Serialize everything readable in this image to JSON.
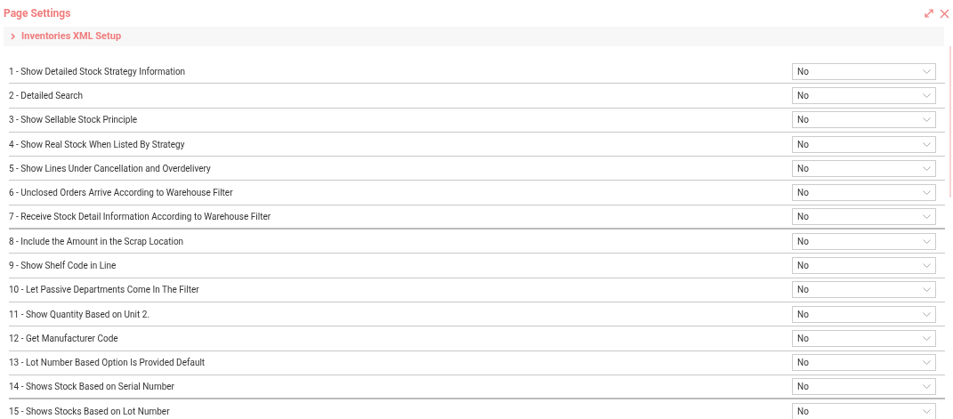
{
  "title": "Page Settings",
  "section": {
    "label": "Inventories XML Setup",
    "expanded": false
  },
  "settings": [
    {
      "label": "1 - Show Detailed Stock Strategy Information",
      "value": "No"
    },
    {
      "label": "2 - Detailed Search",
      "value": "No"
    },
    {
      "label": "3 - Show Sellable Stock Principle",
      "value": "No"
    },
    {
      "label": "4 - Show Real Stock When Listed By Strategy",
      "value": "No"
    },
    {
      "label": "5 - Show Lines Under Cancellation and Overdelivery",
      "value": "No"
    },
    {
      "label": "6 - Unclosed Orders Arrive According to Warehouse Filter",
      "value": "No"
    },
    {
      "label": "7 - Receive Stock Detail Information According to Warehouse Filter",
      "value": "No"
    },
    {
      "label": "8 - Include the Amount in the Scrap Location",
      "value": "No"
    },
    {
      "label": "9 - Show Shelf Code in Line",
      "value": "No"
    },
    {
      "label": "10 - Let Passive Departments Come In The Filter",
      "value": "No"
    },
    {
      "label": "11 - Show Quantity Based on Unit 2.",
      "value": "No"
    },
    {
      "label": "12 - Get Manufacturer Code",
      "value": "No"
    },
    {
      "label": "13 - Lot Number Based Option Is Provided Default",
      "value": "No"
    },
    {
      "label": "14 - Shows Stock Based on Serial Number",
      "value": "No"
    },
    {
      "label": "15 - Shows Stocks Based on Lot Number",
      "value": "No"
    }
  ]
}
